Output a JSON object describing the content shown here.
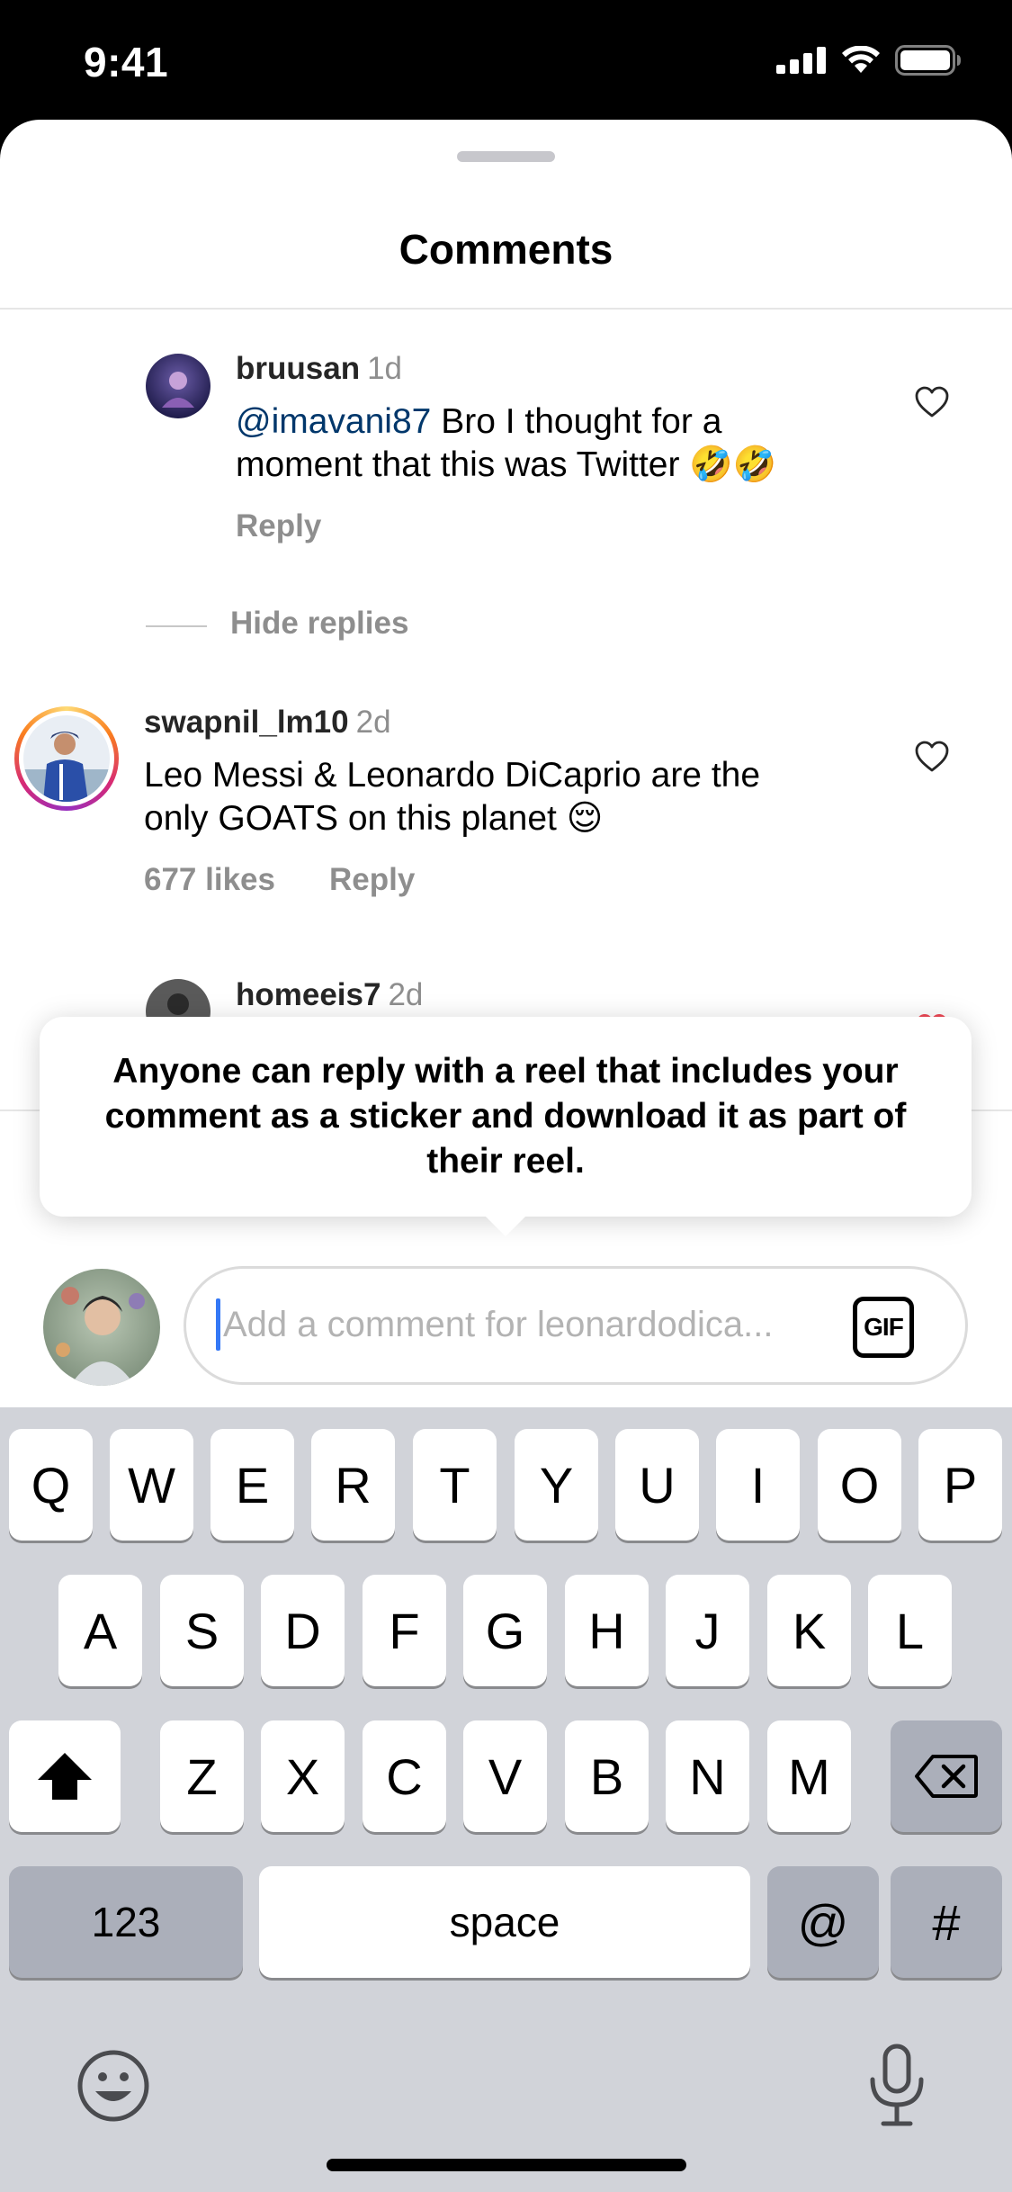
{
  "status_bar": {
    "time": "9:41"
  },
  "sheet": {
    "title": "Comments"
  },
  "comments": [
    {
      "username": "bruusan",
      "time": "1d",
      "mention": "@imavani87",
      "text_line1": " Bro I thought for a",
      "text_line2": "moment that this was Twitter 🤣🤣",
      "reply": "Reply"
    },
    {
      "username": "swapnil_lm10",
      "time": "2d",
      "text_line1": "Leo Messi & Leonardo DiCaprio are the",
      "text_line2": "only GOATS on this planet 😌",
      "likes": "677 likes",
      "reply": "Reply"
    },
    {
      "username": "homeeis7",
      "time": "2d"
    }
  ],
  "hide_replies": "Hide replies",
  "tooltip": {
    "text": "Anyone can reply with a reel that includes your comment as a sticker and download it as part of their reel."
  },
  "input": {
    "placeholder": "Add a comment for leonardodica...",
    "gif_label": "GIF"
  },
  "keyboard": {
    "row1": [
      "Q",
      "W",
      "E",
      "R",
      "T",
      "Y",
      "U",
      "I",
      "O",
      "P"
    ],
    "row2": [
      "A",
      "S",
      "D",
      "F",
      "G",
      "H",
      "J",
      "K",
      "L"
    ],
    "row3": [
      "Z",
      "X",
      "C",
      "V",
      "B",
      "N",
      "M"
    ],
    "numbers_key": "123",
    "space_key": "space",
    "at_key": "@",
    "hash_key": "#"
  }
}
